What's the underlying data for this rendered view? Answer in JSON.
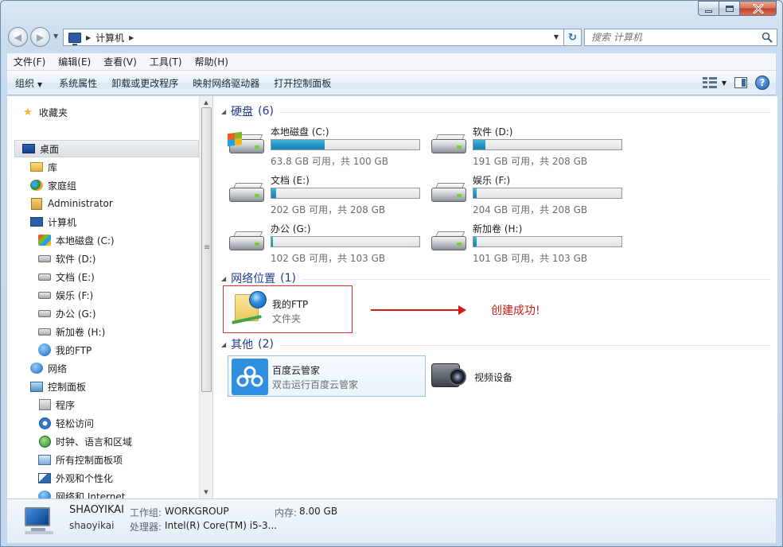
{
  "window": {
    "caption_buttons": [
      "minimize",
      "maximize",
      "close"
    ]
  },
  "address": {
    "crumb": "计算机",
    "search_placeholder": "搜索 计算机"
  },
  "menu": [
    "文件(F)",
    "编辑(E)",
    "查看(V)",
    "工具(T)",
    "帮助(H)"
  ],
  "toolbar": {
    "organize": "组织",
    "commands": [
      "系统属性",
      "卸载或更改程序",
      "映射网络驱动器",
      "打开控制面板"
    ]
  },
  "nav": {
    "favorites": "收藏夹",
    "desktop": "桌面",
    "items": [
      {
        "label": "库",
        "icon": "library-icon"
      },
      {
        "label": "家庭组",
        "icon": "homegroup-icon"
      },
      {
        "label": "Administrator",
        "icon": "user-folder-icon"
      },
      {
        "label": "计算机",
        "icon": "computer-icon"
      },
      {
        "label": "本地磁盘 (C:)",
        "icon": "drive-c-icon"
      },
      {
        "label": "软件 (D:)",
        "icon": "drive-icon"
      },
      {
        "label": "文档 (E:)",
        "icon": "drive-icon"
      },
      {
        "label": "娱乐 (F:)",
        "icon": "drive-icon"
      },
      {
        "label": "办公 (G:)",
        "icon": "drive-icon"
      },
      {
        "label": "新加卷 (H:)",
        "icon": "drive-icon"
      },
      {
        "label": "我的FTP",
        "icon": "ftp-icon"
      },
      {
        "label": "网络",
        "icon": "network-icon"
      },
      {
        "label": "控制面板",
        "icon": "control-panel-icon"
      },
      {
        "label": "程序",
        "icon": "programs-icon"
      },
      {
        "label": "轻松访问",
        "icon": "accessibility-icon"
      },
      {
        "label": "时钟、语言和区域",
        "icon": "clock-icon"
      },
      {
        "label": "所有控制面板项",
        "icon": "all-cp-items-icon"
      },
      {
        "label": "外观和个性化",
        "icon": "appearance-icon"
      },
      {
        "label": "网络和 Internet",
        "icon": "network-internet-icon"
      }
    ]
  },
  "groups": {
    "hdd": {
      "title": "硬盘",
      "count": "(6)"
    },
    "network": {
      "title": "网络位置",
      "count": "(1)"
    },
    "other": {
      "title": "其他",
      "count": "(2)"
    }
  },
  "drives": [
    {
      "name": "本地磁盘 (C:)",
      "size": "63.8 GB 可用，共 100 GB",
      "used_fraction": 0.36,
      "windows": true
    },
    {
      "name": "软件 (D:)",
      "size": "191 GB 可用，共 208 GB",
      "used_fraction": 0.08
    },
    {
      "name": "文档 (E:)",
      "size": "202 GB 可用，共 208 GB",
      "used_fraction": 0.03
    },
    {
      "name": "娱乐 (F:)",
      "size": "204 GB 可用，共 208 GB",
      "used_fraction": 0.02
    },
    {
      "name": "办公 (G:)",
      "size": "102 GB 可用，共 103 GB",
      "used_fraction": 0.01
    },
    {
      "name": "新加卷 (H:)",
      "size": "101 GB 可用，共 103 GB",
      "used_fraction": 0.02
    }
  ],
  "network_item": {
    "name": "我的FTP",
    "type": "文件夹"
  },
  "annotation": {
    "text": "创建成功!",
    "color": "#d21d14"
  },
  "other_items": {
    "baidu": {
      "name": "百度云管家",
      "desc": "双击运行百度云管家"
    },
    "camera": {
      "name": "视频设备"
    }
  },
  "details": {
    "pc_name": "SHAOYIKAI",
    "user": "shaoyikai",
    "workgroup_label": "工作组:",
    "workgroup_value": "WORKGROUP",
    "memory_label": "内存:",
    "memory_value": "8.00 GB",
    "cpu_label": "处理器:",
    "cpu_value": "Intel(R) Core(TM) i5-3..."
  }
}
